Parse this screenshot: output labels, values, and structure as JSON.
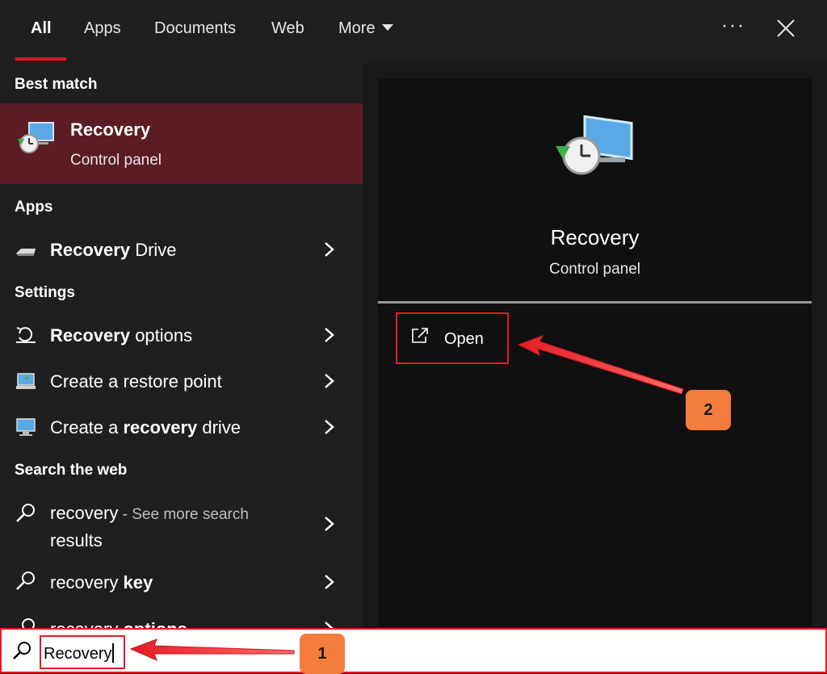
{
  "tabs": [
    {
      "label": "All"
    },
    {
      "label": "Apps"
    },
    {
      "label": "Documents"
    },
    {
      "label": "Web"
    },
    {
      "label": "More"
    }
  ],
  "toolbar": {
    "more_options": "···"
  },
  "left": {
    "best_match_header": "Best match",
    "best_match": {
      "title": "Recovery",
      "subtitle": "Control panel"
    },
    "apps_header": "Apps",
    "apps": [
      {
        "bold": "Recovery",
        "rest": " Drive"
      }
    ],
    "settings_header": "Settings",
    "settings": [
      {
        "bold": "Recovery",
        "rest": " options"
      },
      {
        "plain": "Create a restore point"
      },
      {
        "pre": "Create a ",
        "bold": "recovery",
        "rest": " drive"
      }
    ],
    "web_header": "Search the web",
    "web": [
      {
        "text": "recovery",
        "sub": " - See more search",
        "sub2": "results"
      },
      {
        "pre": "recovery ",
        "bold": "key"
      },
      {
        "pre": "recovery ",
        "bold": "options"
      }
    ]
  },
  "right": {
    "title": "Recovery",
    "subtitle": "Control panel",
    "open_label": "Open"
  },
  "search": {
    "value": "Recovery"
  },
  "annotations": {
    "step1": "1",
    "step2": "2"
  },
  "colors": {
    "accent_red": "#e81123",
    "selected_bg": "#5c1c24",
    "badge": "#f47c3c"
  }
}
